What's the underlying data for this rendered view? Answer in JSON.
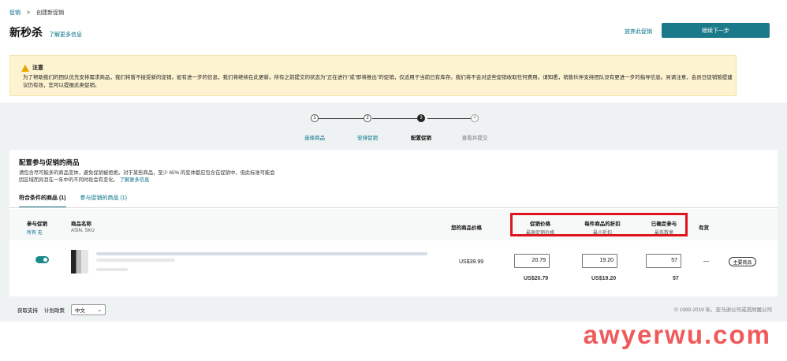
{
  "breadcrumb": {
    "root": "促销",
    "separator": ">",
    "current": "创建新促销"
  },
  "header": {
    "title": "新秒杀",
    "learn_more": "了解更多信息",
    "abandon": "放弃此促销",
    "continue": "继续下一步"
  },
  "notice": {
    "title": "注意",
    "body": "为了帮助我们的团队优先安排需求商品，我们将暂不接受新的促销。如有进一步的信息，我们将继续在此更新。所有之前提交的状态为\"正在进行\"或\"即将推出\"的促销，仅适用于当前已有库存。我们将不会对这些促销收取任何费用。请知悉，销售伙伴支持团队没有更进一步的指导信息。另请注意，会员日促销暂提建议仍有效，您可以提报此类促销。"
  },
  "steps": [
    {
      "num": "1",
      "label": "选择商品"
    },
    {
      "num": "2",
      "label": "安排促销"
    },
    {
      "num": "3",
      "label": "配置促销"
    },
    {
      "num": "4",
      "label": "查看并提交"
    }
  ],
  "section": {
    "title": "配置参与促销的商品",
    "desc_line1": "请包含尽可能多的商品变体，避免促销被拒绝。对于某些商品，至少 65% 的变体都应包含在促销中，但此标准可能会",
    "desc_line2": "因区域而异且在一年中的不同时段会有变化。",
    "desc_link": "了解更多信息"
  },
  "tabs": [
    {
      "label": "符合条件的商品 (1)"
    },
    {
      "label": "参与促销的商品 (1)"
    }
  ],
  "table": {
    "col_participate": "参与促销",
    "col_participate_sub": "所有 无",
    "col_name": "商品名称",
    "col_name_sub": "ASIN, SKU",
    "col_your_price": "您的商品价格",
    "col_promo_price": "促销价格",
    "col_promo_price_sub": "最高促销价格",
    "col_discount": "每件商品的折扣",
    "col_discount_sub": "最小折扣",
    "col_qty": "已确定参与",
    "col_qty_sub": "最低数量",
    "col_stock": "有货",
    "row": {
      "your_price": "US$39.99",
      "promo_price": "20.79",
      "promo_price_below": "US$20.79",
      "discount": "19.20",
      "discount_below": "US$19.20",
      "qty": "57",
      "qty_below": "57",
      "stock": "—",
      "badge": "主要商品"
    }
  },
  "footer": {
    "support": "获取支持",
    "policy": "计划政策",
    "language": "中文",
    "copyright": "© 1999-2019 年，亚马逊公司或其附属公司"
  },
  "watermark": "awyerwu.com",
  "colors": {
    "accent": "#1a7a8a",
    "link": "#007185",
    "highlight": "#e0141e",
    "notice_bg": "#fdf3d0"
  }
}
